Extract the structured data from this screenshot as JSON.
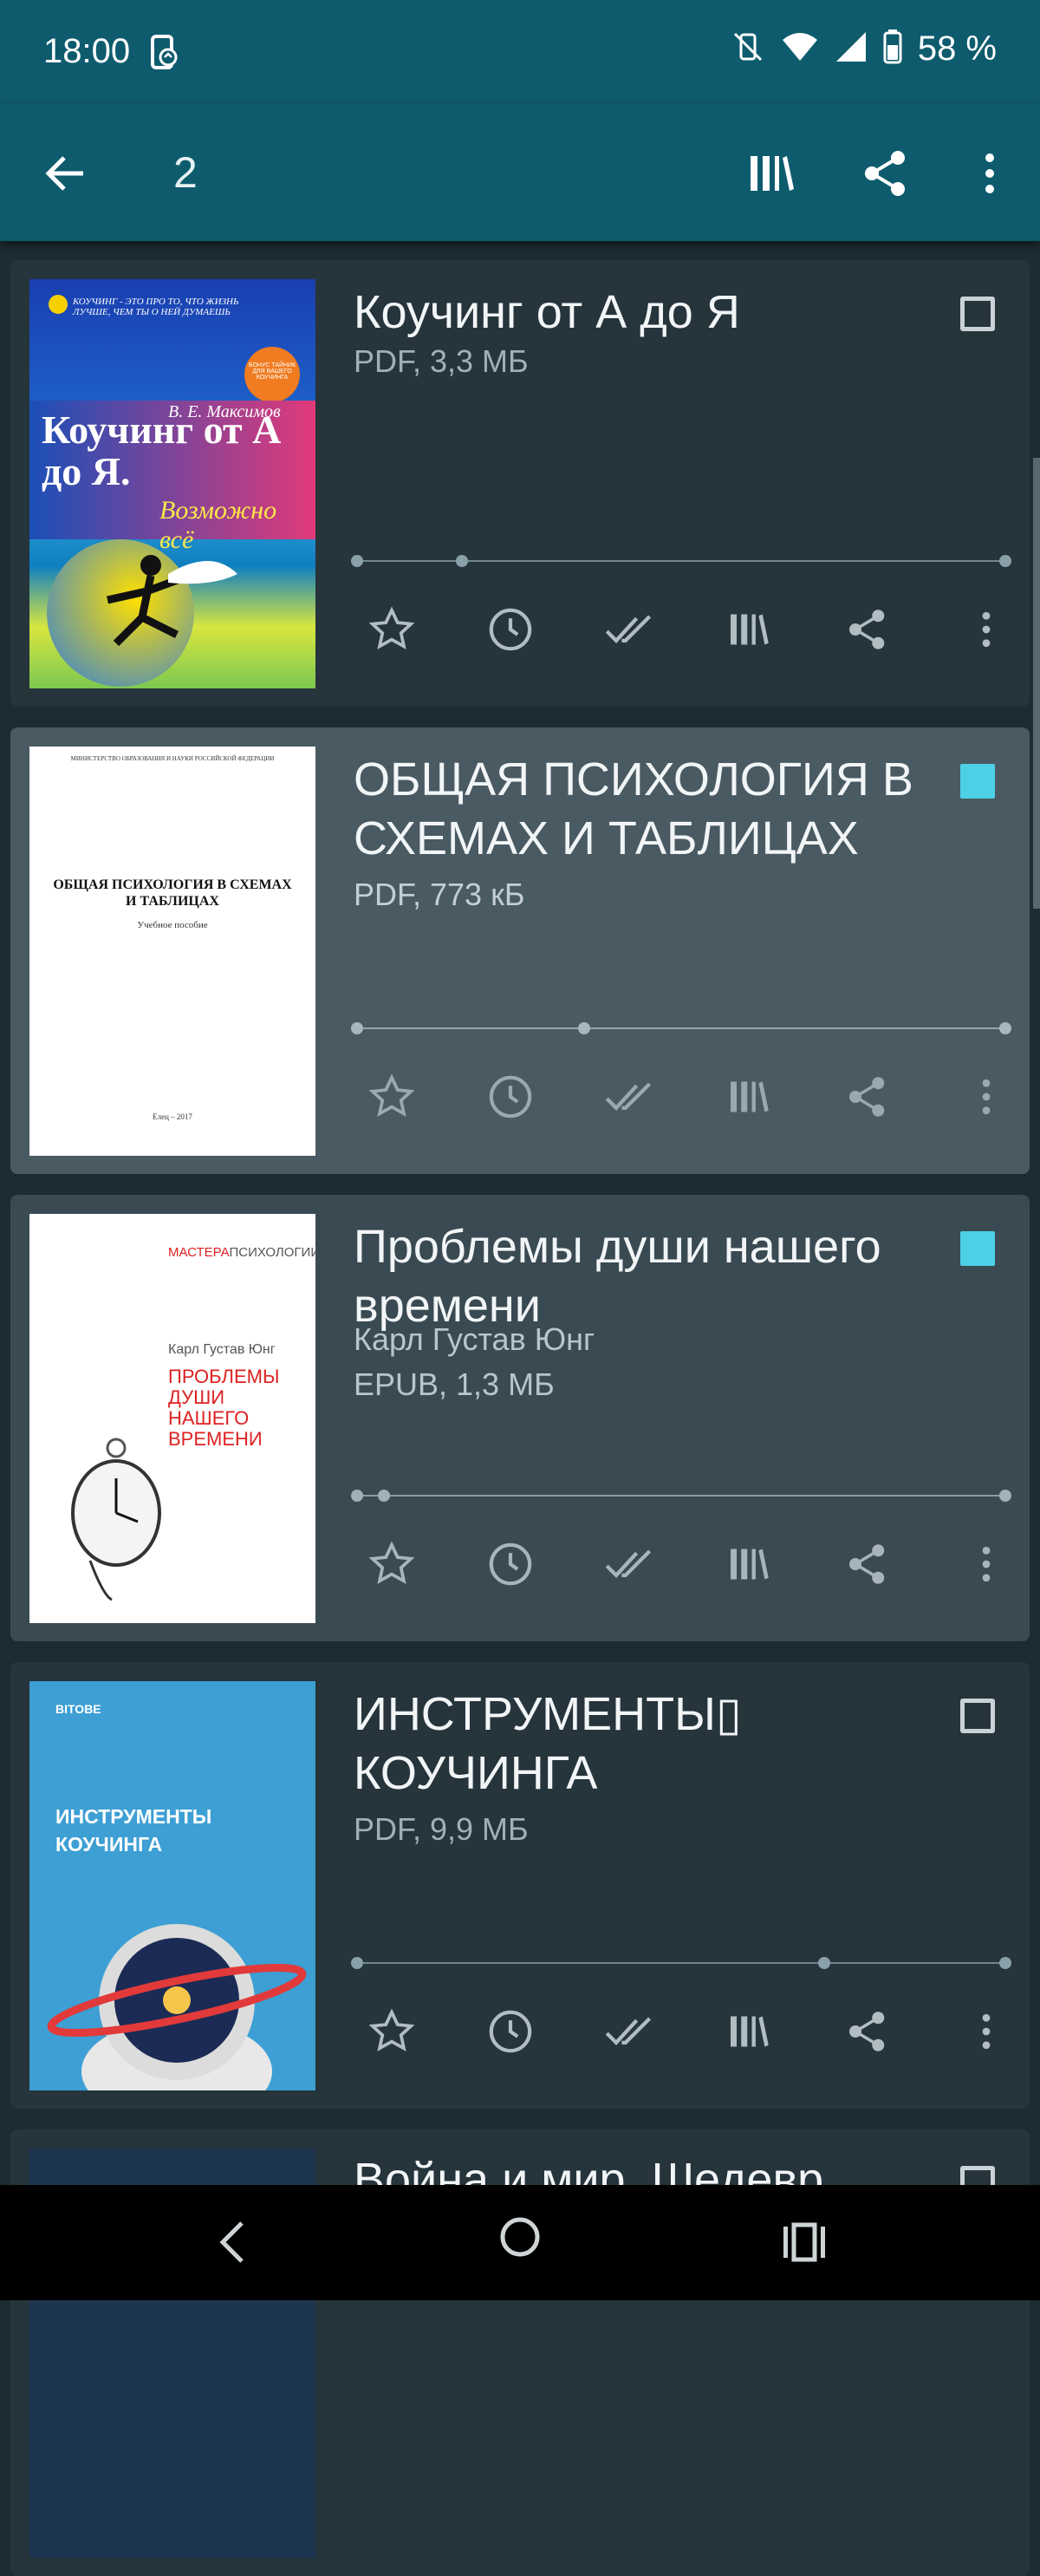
{
  "status_bar": {
    "time": "18:00",
    "battery": "58 %"
  },
  "app_bar": {
    "title": "2"
  },
  "books": [
    {
      "title": "Коучинг от А до Я",
      "author": "",
      "meta": "PDF, 3,3 МБ",
      "checked": false,
      "progress": 0.1,
      "cover": {
        "top_text": "КОУЧИНГ - ЭТО ПРО ТО, ЧТО ЖИЗНЬ ЛУЧШЕ, ЧЕМ ТЫ О НЕЙ ДУМАЕШЬ",
        "author": "В. Е. Максимов",
        "title": "Коучинг от А до Я.",
        "subtitle": "Возможно всё",
        "badge": "БОНУС ТАЙНИК ДЛЯ ВАШЕГО КОУЧИНГА"
      }
    },
    {
      "title": "ОБЩАЯ ПСИХОЛОГИЯ В СХЕМАХ И ТАБЛИЦАХ",
      "author": "",
      "meta": "PDF, 773 кБ",
      "checked": true,
      "progress": 0.35,
      "cover": {
        "top_text": "МИНИСТЕРСТВО ОБРАЗОВАНИЯ И НАУКИ РОССИЙСКОЙ ФЕДЕРАЦИИ",
        "title": "ОБЩАЯ ПСИХОЛОГИЯ В СХЕМАХ И ТАБЛИЦАХ",
        "subtitle": "Учебное пособие",
        "footer": "Елец – 2017"
      }
    },
    {
      "title": "Проблемы души нашего времени",
      "author": "Карл Густав Юнг",
      "meta": "EPUB, 1,3 МБ",
      "checked": true,
      "progress": 0.04,
      "cover": {
        "series_a": "МАСТЕРА",
        "series_b": "ПСИХОЛОГИИ",
        "author": "Карл Густав Юнг",
        "title": "ПРОБЛЕМЫ ДУШИ НАШЕГО ВРЕМЕНИ"
      }
    },
    {
      "title": "ИНСТРУМЕНТЫ▯\n КОУЧИНГА",
      "author": "",
      "meta": "PDF, 9,9 МБ",
      "checked": false,
      "progress": 0.72,
      "cover": {
        "publisher": "BITOBE",
        "title": "ИНСТРУМЕНТЫ КОУЧИНГА"
      }
    },
    {
      "title": "Война и мир. Шедевр",
      "author": "",
      "meta": "",
      "checked": false,
      "progress": 0
    }
  ],
  "colors": {
    "accent": "#4dd0e6",
    "app_bar": "#0e5b6e"
  }
}
